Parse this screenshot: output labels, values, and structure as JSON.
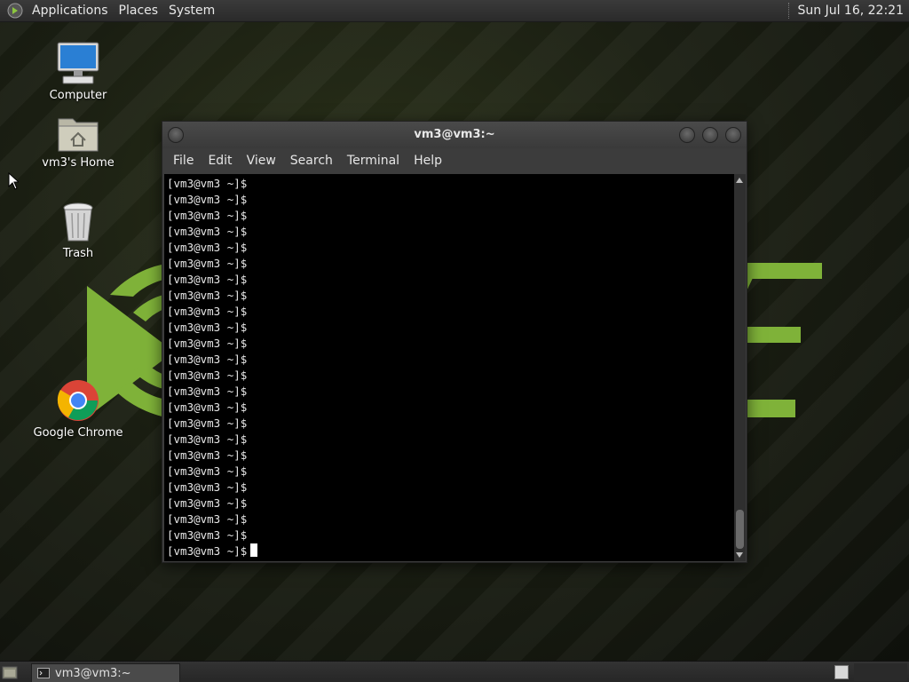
{
  "top_panel": {
    "menus": [
      "Applications",
      "Places",
      "System"
    ],
    "clock": "Sun Jul 16, 22:21"
  },
  "desktop_icons": [
    {
      "label": "Computer",
      "icon": "computer-icon"
    },
    {
      "label": "vm3's Home",
      "icon": "home-folder-icon"
    },
    {
      "label": "Trash",
      "icon": "trash-icon"
    },
    {
      "label": "Google Chrome",
      "icon": "chrome-icon"
    }
  ],
  "terminal": {
    "title": "vm3@vm3:~",
    "menu": [
      "File",
      "Edit",
      "View",
      "Search",
      "Terminal",
      "Help"
    ],
    "prompt": "[vm3@vm3 ~]$",
    "prompt_line_count": 24
  },
  "bottom_panel": {
    "task_label": "vm3@vm3:~"
  },
  "colors": {
    "accent_green": "#8cc63f",
    "terminal_bg": "#000000",
    "terminal_fg": "#e8e8e8",
    "panel_bg": "#2e2e2e"
  }
}
